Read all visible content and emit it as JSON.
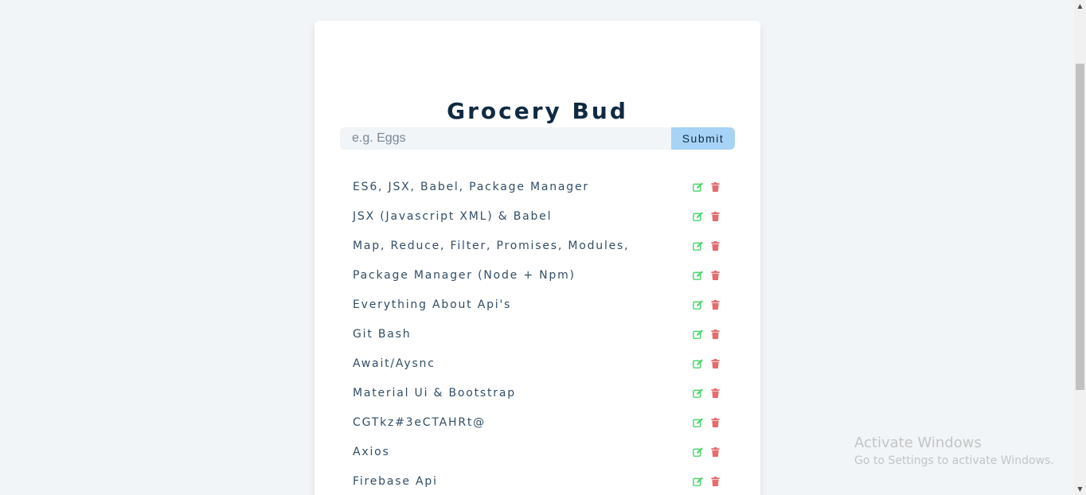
{
  "app": {
    "title": "Grocery Bud"
  },
  "form": {
    "placeholder": "e.g. Eggs",
    "value": "",
    "submit_label": "Submit"
  },
  "items": [
    "ES6, JSX, Babel, Package Manager",
    "JSX (Javascript XML) & Babel",
    "Map, Reduce, Filter, Promises, Modules,",
    "Package Manager (Node + Npm)",
    "Everything About Api's",
    "Git Bash",
    "Await/Aysnc",
    "Material Ui & Bootstrap",
    "CGTkz#3eCTAHRt@",
    "Axios",
    "Firebase Api"
  ],
  "icons": {
    "edit": "edit-icon",
    "delete": "trash-icon",
    "edit_color": "#4ad66d",
    "delete_color": "#e66b6b"
  },
  "watermark": {
    "title": "Activate Windows",
    "subtitle": "Go to Settings to activate Windows."
  }
}
